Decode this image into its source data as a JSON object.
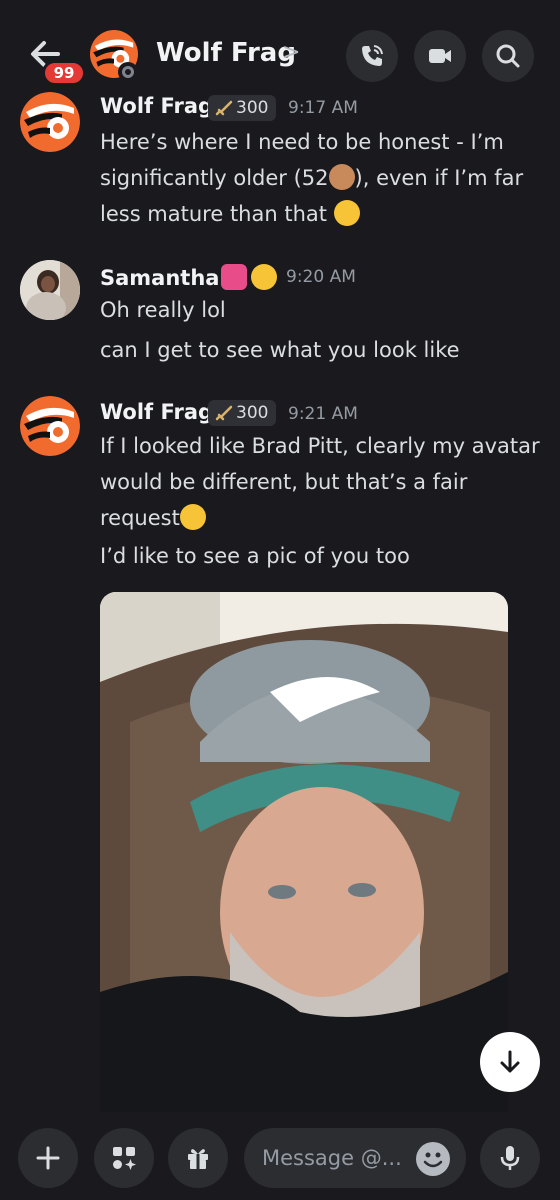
{
  "header": {
    "title": "Wolf Frag",
    "chevron": ">",
    "unread_badge": "99",
    "icons": [
      "back-arrow-icon",
      "phone-call-icon",
      "video-camera-icon",
      "search-icon"
    ]
  },
  "messages": [
    {
      "author": "Wolf Frag",
      "role_badge": "300",
      "time": "9:17 AM",
      "lines": [
        {
          "t1": "Here’s where I need to be honest - I’m",
          "t2": "significantly older (52",
          "t3": "), even if I’m far",
          "t4": "less mature than that"
        }
      ]
    },
    {
      "author": "Samantha",
      "time": "9:20 AM",
      "lines": [
        "Oh really lol",
        "can I get to see what you look like"
      ]
    },
    {
      "author": "Wolf Frag",
      "role_badge": "300",
      "time": "9:21 AM",
      "lines": [
        "If I looked like Brad Pitt, clearly my avatar",
        "would be different, but that’s a fair",
        "request",
        "I’d like to see a pic of you too"
      ]
    }
  ],
  "composer": {
    "placeholder": "Message @..."
  },
  "colors": {
    "background": "#1a1a1e",
    "button_bg": "#2b2d31",
    "badge_red": "#e53935",
    "flyers_orange": "#f26b2e",
    "timestamp": "#949ba4"
  }
}
